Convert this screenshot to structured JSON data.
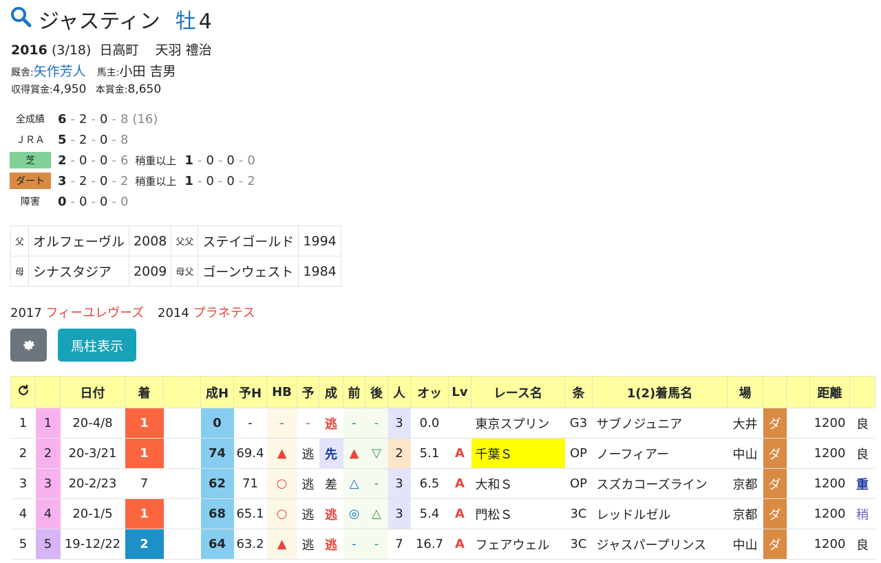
{
  "horse": {
    "name": "ジャスティン",
    "sex": "牡",
    "age": "4"
  },
  "birth": {
    "year": "2016",
    "date": "(3/18)",
    "place": "日高町",
    "breeder": "天羽 禮治"
  },
  "stable": {
    "trainer_label": "厩舎:",
    "trainer": "矢作芳人",
    "owner_label": "馬主:",
    "owner": "小田 吉男"
  },
  "prize": {
    "earned_label": "収得賞金:",
    "earned": "4,950",
    "main_label": "本賞金:",
    "main": "8,650"
  },
  "records": [
    {
      "label": "全成績",
      "v": [
        "6",
        "2",
        "0",
        "8"
      ],
      "extra": "(16)"
    },
    {
      "label": "ＪＲＡ",
      "v": [
        "5",
        "2",
        "0",
        "8"
      ]
    },
    {
      "label": "芝",
      "v": [
        "2",
        "0",
        "0",
        "6"
      ],
      "sub_label": "稍重以上",
      "sv": [
        "1",
        "0",
        "0",
        "0"
      ]
    },
    {
      "label": "ダート",
      "v": [
        "3",
        "2",
        "0",
        "2"
      ],
      "sub_label": "稍重以上",
      "sv": [
        "1",
        "0",
        "0",
        "2"
      ]
    },
    {
      "label": "障害",
      "v": [
        "0",
        "0",
        "0",
        "0"
      ]
    }
  ],
  "pedigree": {
    "sire_k": "父",
    "sire": "オルフェーヴル",
    "sire_year": "2008",
    "sire_sire_k": "父父",
    "sire_sire": "ステイゴールド",
    "sire_sire_year": "1994",
    "dam_k": "母",
    "dam": "シナスタジア",
    "dam_year": "2009",
    "dam_sire_k": "母父",
    "dam_sire": "ゴーンウェスト",
    "dam_sire_year": "1984"
  },
  "siblings": [
    {
      "year": "2017",
      "name": "フィーユレヴーズ"
    },
    {
      "year": "2014",
      "name": "プラネテス"
    }
  ],
  "buttons": {
    "settings_icon": "gear-icon",
    "bar_label": "馬柱表示"
  },
  "colors": {
    "turf": "#7fd197",
    "dirt": "#d98a43",
    "header": "#ffffa0",
    "win": "#fb6641",
    "second": "#1e90c8",
    "link": "#1a73c8",
    "red": "#e8453c"
  },
  "table": {
    "headers": [
      "↻",
      "",
      "日付",
      "着",
      "",
      "成H",
      "予H",
      "HB",
      "予",
      "成",
      "前",
      "後",
      "人",
      "オッ",
      "Lv",
      "レース名",
      "条",
      "1(2)着馬名",
      "場",
      "",
      "",
      "距離",
      ""
    ],
    "rows": [
      {
        "i": "1",
        "no": "1",
        "date": "20-4/8",
        "res": "1",
        "sei": "0",
        "yoh": "-",
        "hb": "-",
        "yo": "-",
        "sei2": "逃",
        "mae": "-",
        "ato": "-",
        "pop": "3",
        "odds": "0.0",
        "lv": "",
        "race": "東京スプリン",
        "cls": "G3",
        "opp": "サブノジュニア",
        "place": "大井",
        "surf": "ダ",
        "dist": "1200",
        "cond": "良"
      },
      {
        "i": "2",
        "no": "2",
        "date": "20-3/21",
        "res": "1",
        "sei": "74",
        "yoh": "69.4",
        "hb": "▲",
        "yo": "逃",
        "sei2": "先",
        "mae": "▲",
        "ato": "▽",
        "pop": "2",
        "odds": "5.1",
        "lv": "A",
        "race": "千葉Ｓ",
        "cls": "OP",
        "opp": "ノーフィアー",
        "place": "中山",
        "surf": "ダ",
        "dist": "1200",
        "cond": "良"
      },
      {
        "i": "3",
        "no": "3",
        "date": "20-2/23",
        "res": "7",
        "sei": "62",
        "yoh": "71",
        "hb": "○",
        "yo": "逃",
        "sei2": "差",
        "mae": "△",
        "ato": "-",
        "pop": "3",
        "odds": "6.5",
        "lv": "A",
        "race": "大和Ｓ",
        "cls": "OP",
        "opp": "スズカコーズライン",
        "place": "京都",
        "surf": "ダ",
        "dist": "1200",
        "cond": "重"
      },
      {
        "i": "4",
        "no": "4",
        "date": "20-1/5",
        "res": "1",
        "sei": "68",
        "yoh": "65.1",
        "hb": "○",
        "yo": "逃",
        "sei2": "逃",
        "mae": "◎",
        "ato": "△",
        "pop": "3",
        "odds": "5.4",
        "lv": "A",
        "race": "門松Ｓ",
        "cls": "3C",
        "opp": "レッドルゼル",
        "place": "京都",
        "surf": "ダ",
        "dist": "1200",
        "cond": "稍"
      },
      {
        "i": "5",
        "no": "5",
        "date": "19-12/22",
        "res": "2",
        "sei": "64",
        "yoh": "63.2",
        "hb": "▲",
        "yo": "逃",
        "sei2": "逃",
        "mae": "-",
        "ato": "-",
        "pop": "7",
        "odds": "16.7",
        "lv": "A",
        "race": "フェアウェル",
        "cls": "3C",
        "opp": "ジャスパープリンス",
        "place": "中山",
        "surf": "ダ",
        "dist": "1200",
        "cond": "良"
      }
    ]
  }
}
